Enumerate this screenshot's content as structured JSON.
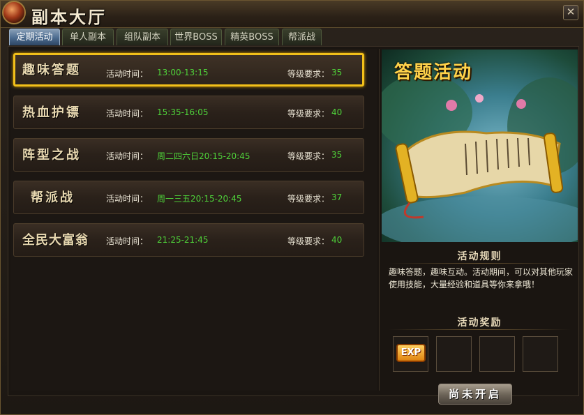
{
  "window": {
    "title": "副本大厅",
    "close_icon": "close-icon"
  },
  "tabs": [
    {
      "label": "定期活动",
      "active": true
    },
    {
      "label": "单人副本"
    },
    {
      "label": "组队副本"
    },
    {
      "label": "世界BOSS"
    },
    {
      "label": "精英BOSS"
    },
    {
      "label": "帮派战"
    }
  ],
  "activities": [
    {
      "name": "趣味答题",
      "time_label": "活动时间：",
      "time": "13:00-13:15",
      "level_label": "等级要求：",
      "level": "35",
      "selected": true
    },
    {
      "name": "热血护镖",
      "time_label": "活动时间：",
      "time": "15:35-16:05",
      "level_label": "等级要求：",
      "level": "40"
    },
    {
      "name": "阵型之战",
      "time_label": "活动时间：",
      "time": "周二四六日20:15-20:45",
      "level_label": "等级要求：",
      "level": "35"
    },
    {
      "name": "帮派战",
      "time_label": "活动时间：",
      "time": "周一三五20:15-20:45",
      "level_label": "等级要求：",
      "level": "37"
    },
    {
      "name": "全民大富翁",
      "time_label": "活动时间：",
      "time": "21:25-21:45",
      "level_label": "等级要求：",
      "level": "40"
    }
  ],
  "detail": {
    "art_title": "答题活动",
    "rules_heading": "活动规则",
    "rules_text": "趣味答题，趣味互动。活动期间，可以对其他玩家使用技能，大量经验和道具等你来拿哦！",
    "rewards_heading": "活动奖励",
    "reward_item": "EXP",
    "start_button": "尚未开启"
  },
  "colors": {
    "accent_gold": "#f2c01a",
    "value_green": "#4fd23a",
    "tab_active": "#4a6a8e"
  }
}
